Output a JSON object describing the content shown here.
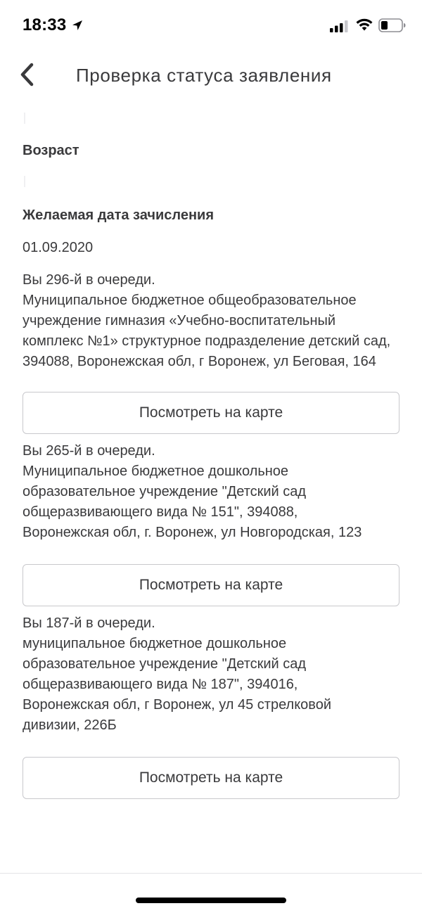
{
  "status_bar": {
    "time": "18:33",
    "icons": [
      "location-arrow-icon",
      "cellular-signal-icon",
      "wifi-icon",
      "battery-icon"
    ]
  },
  "nav": {
    "title": "Проверка статуса заявления",
    "back_icon": "chevron-left-icon"
  },
  "fields": {
    "age_label": "Возраст",
    "date_label": "Желаемая дата зачисления",
    "date_value": "01.09.2020"
  },
  "queue": [
    {
      "position": "Вы 296-й в очереди.",
      "organization": "Муниципальное бюджетное общеобразовательное учреждение гимназия «Учебно-воспитательный комплекс №1» структурное подразделение детский сад, 394088, Воронежская обл, г Воронеж, ул Беговая, 164",
      "button_label": "Посмотреть на карте"
    },
    {
      "position": "Вы 265-й в очереди.",
      "organization": "Муниципальное бюджетное дошкольное образовательное учреждение \"Детский сад общеразвивающего вида № 151\", 394088, Воронежская обл, г. Воронеж, ул Новгородская, 123",
      "button_label": "Посмотреть на карте"
    },
    {
      "position": "Вы 187-й в очереди.",
      "organization": "муниципальное бюджетное дошкольное образовательное учреждение \"Детский сад общеразвивающего вида № 187\", 394016, Воронежская обл, г Воронеж, ул 45 стрелковой дивизии, 226Б",
      "button_label": "Посмотреть на карте"
    }
  ],
  "colors": {
    "text": "#3a3a3c",
    "button_border": "#c8c8cc",
    "background": "#ffffff"
  }
}
